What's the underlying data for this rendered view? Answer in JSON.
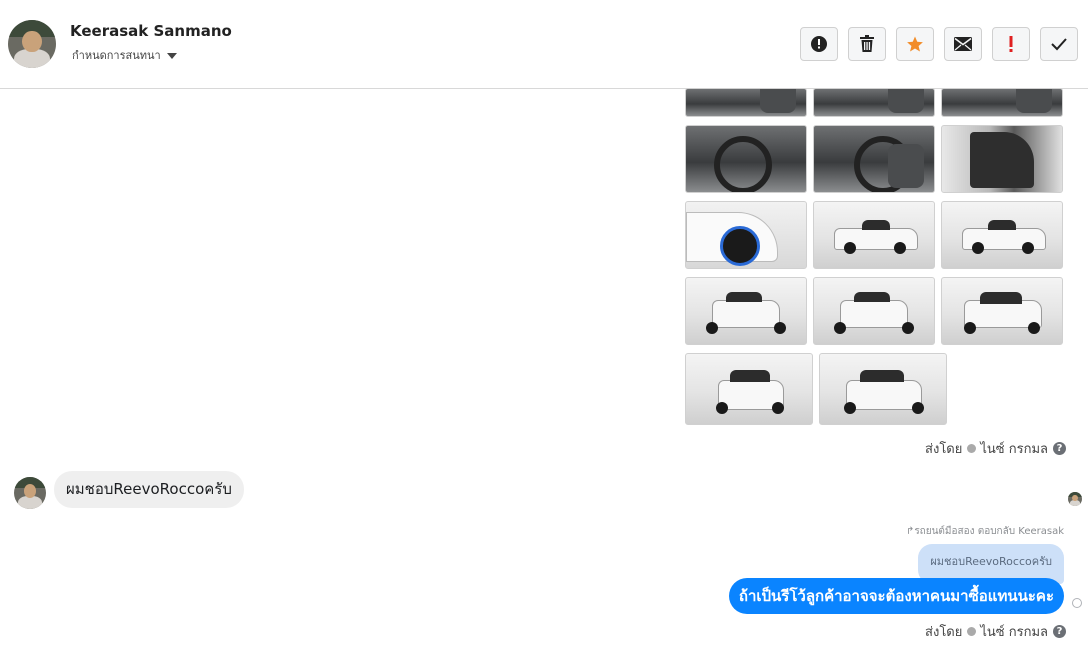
{
  "header": {
    "contact_name": "Keerasak Sanmano",
    "assign_label": "กำหนดการสนทนา",
    "actions": [
      {
        "name": "mark-spam-button",
        "icon": "alert-circle-icon",
        "color": "#222222"
      },
      {
        "name": "delete-button",
        "icon": "trash-icon",
        "color": "#222222"
      },
      {
        "name": "star-button",
        "icon": "star-icon",
        "color": "#f28c28"
      },
      {
        "name": "mark-unread-button",
        "icon": "envelope-icon",
        "color": "#222222"
      },
      {
        "name": "follow-up-button",
        "icon": "exclamation-icon",
        "color": "#e02020"
      },
      {
        "name": "mark-done-button",
        "icon": "checkmark-icon",
        "color": "#222222"
      }
    ]
  },
  "gallery": {
    "photos": [
      "car-interior-photo",
      "car-interior-photo",
      "car-interior-photo",
      "car-dashboard-photo",
      "car-cabin-photo",
      "car-door-photo",
      "car-fender-photo",
      "car-side-photo",
      "car-side-photo",
      "car-rear-photo",
      "car-rear-photo",
      "car-front-photo",
      "car-front-photo",
      "car-front-photo"
    ]
  },
  "messages": {
    "sent_by_1": {
      "prefix": "ส่งโดย",
      "sender": "ไนซ์ กรกมล",
      "help": "?"
    },
    "incoming_text": "ผมชอบReevoRoccoครับ",
    "reply_note": "รถยนต์มือสอง ตอบกลับ Keerasak",
    "quoted_text": "ผมชอบReevoRoccoครับ",
    "outgoing_text": "ถ้าเป็นรีโว้ลูกค้าอาจจะต้องหาคนมาซื้อแทนนะคะ",
    "sent_by_2": {
      "prefix": "ส่งโดย",
      "sender": "ไนซ์ กรกมล",
      "help": "?"
    }
  },
  "colors": {
    "outgoing_bubble": "#0a84ff",
    "quoted_bubble": "#cde0f8",
    "incoming_bubble": "#efefef"
  }
}
